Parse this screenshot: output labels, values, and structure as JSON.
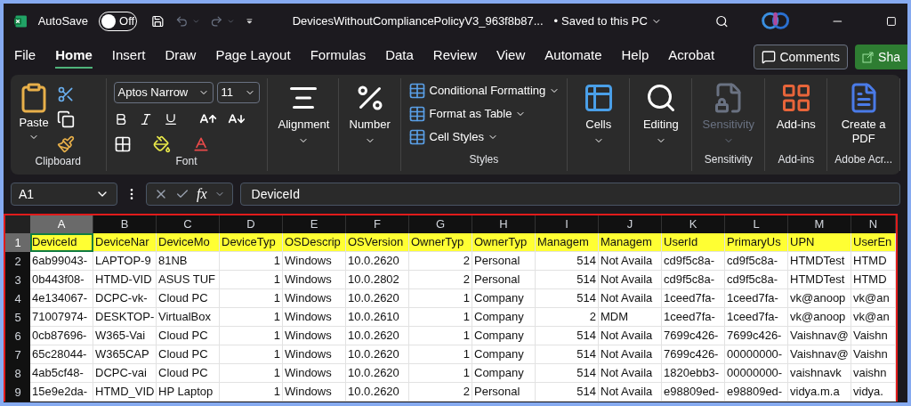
{
  "title_bar": {
    "autosave_label": "AutoSave",
    "autosave": {
      "on": false,
      "label": "Off"
    },
    "document_title": "DevicesWithoutCompliancePolicyV3_963f8b87...",
    "separator": "•",
    "save_status": "Saved to this PC"
  },
  "menu_tabs": [
    {
      "label": "File",
      "selected": false
    },
    {
      "label": "Home",
      "selected": true
    },
    {
      "label": "Insert",
      "selected": false
    },
    {
      "label": "Draw",
      "selected": false
    },
    {
      "label": "Page Layout",
      "selected": false
    },
    {
      "label": "Formulas",
      "selected": false
    },
    {
      "label": "Data",
      "selected": false
    },
    {
      "label": "Review",
      "selected": false
    },
    {
      "label": "View",
      "selected": false
    },
    {
      "label": "Automate",
      "selected": false
    },
    {
      "label": "Help",
      "selected": false
    },
    {
      "label": "Acrobat",
      "selected": false
    }
  ],
  "comments_button": "Comments",
  "share_button": "Sha",
  "ribbon": {
    "clipboard": {
      "paste": "Paste",
      "group": "Clipboard"
    },
    "font": {
      "name": "Aptos Narrow",
      "size": "11",
      "group": "Font"
    },
    "alignment": "Alignment",
    "number": "Number",
    "styles": {
      "items": [
        "Conditional Formatting",
        "Format as Table",
        "Cell Styles"
      ],
      "group": "Styles"
    },
    "big_groups": [
      {
        "kind": "cells",
        "label": "Cells",
        "disabled": false
      },
      {
        "kind": "editing",
        "label": "Editing",
        "disabled": false
      },
      {
        "kind": "sensitivity",
        "label": "Sensitivity",
        "disabled": true,
        "group": "Sensitivity"
      },
      {
        "kind": "addins",
        "label": "Add-ins",
        "disabled": false,
        "group": "Add-ins"
      },
      {
        "kind": "pdf",
        "label": "Create a PDF",
        "disabled": false,
        "group": "Adobe Acr..."
      }
    ]
  },
  "formula_bar": {
    "name_box": "A1",
    "fx": "fx",
    "formula": "DeviceId"
  },
  "grid": {
    "columns": [
      {
        "letter": "A",
        "selected": true,
        "kind": "text"
      },
      {
        "letter": "B",
        "selected": false,
        "kind": "text"
      },
      {
        "letter": "C",
        "selected": false,
        "kind": "text"
      },
      {
        "letter": "D",
        "selected": false,
        "kind": "number"
      },
      {
        "letter": "E",
        "selected": false,
        "kind": "text"
      },
      {
        "letter": "F",
        "selected": false,
        "kind": "text"
      },
      {
        "letter": "G",
        "selected": false,
        "kind": "number"
      },
      {
        "letter": "H",
        "selected": false,
        "kind": "text"
      },
      {
        "letter": "I",
        "selected": false,
        "kind": "number"
      },
      {
        "letter": "J",
        "selected": false,
        "kind": "text"
      },
      {
        "letter": "K",
        "selected": false,
        "kind": "text"
      },
      {
        "letter": "L",
        "selected": false,
        "kind": "text"
      },
      {
        "letter": "M",
        "selected": false,
        "kind": "text"
      },
      {
        "letter": "N",
        "selected": false,
        "kind": "text"
      }
    ],
    "rows": [
      {
        "number": "1",
        "selected": true,
        "header": true,
        "cells": [
          "DeviceId",
          "DeviceNar",
          "DeviceMo",
          "DeviceTyp",
          "OSDescrip",
          "OSVersion",
          "OwnerTyp",
          "OwnerTyp",
          "Managem",
          "Managem",
          "UserId",
          "PrimaryUs",
          "UPN",
          "UserEn"
        ]
      },
      {
        "number": "2",
        "selected": false,
        "header": false,
        "cells": [
          "6ab99043-",
          "LAPTOP-9",
          "81NB",
          "1",
          "Windows",
          "10.0.2620",
          "2",
          "Personal",
          "514",
          "Not Availa",
          "cd9f5c8a-",
          "cd9f5c8a-",
          "HTMDTest",
          "HTMD"
        ]
      },
      {
        "number": "3",
        "selected": false,
        "header": false,
        "cells": [
          "0b443f08-",
          "HTMD-VID",
          "ASUS TUF",
          "1",
          "Windows",
          "10.0.2802",
          "2",
          "Personal",
          "514",
          "Not Availa",
          "cd9f5c8a-",
          "cd9f5c8a-",
          "HTMDTest",
          "HTMD"
        ]
      },
      {
        "number": "4",
        "selected": false,
        "header": false,
        "cells": [
          "4e134067-",
          "DCPC-vk-",
          "Cloud PC",
          "1",
          "Windows",
          "10.0.2620",
          "1",
          "Company",
          "514",
          "Not Availa",
          "1ceed7fa-",
          "1ceed7fa-",
          "vk@anoop",
          "vk@an"
        ]
      },
      {
        "number": "5",
        "selected": false,
        "header": false,
        "cells": [
          "71007974-",
          "DESKTOP-",
          "VirtualBox",
          "1",
          "Windows",
          "10.0.2610",
          "1",
          "Company",
          "2",
          "MDM",
          "1ceed7fa-",
          "1ceed7fa-",
          "vk@anoop",
          "vk@an"
        ]
      },
      {
        "number": "6",
        "selected": false,
        "header": false,
        "cells": [
          "0cb87696-",
          "W365-Vai",
          "Cloud PC",
          "1",
          "Windows",
          "10.0.2620",
          "1",
          "Company",
          "514",
          "Not Availa",
          "7699c426-",
          "7699c426-",
          "Vaishnav@",
          "Vaishn"
        ]
      },
      {
        "number": "7",
        "selected": false,
        "header": false,
        "cells": [
          "65c28044-",
          "W365CAP",
          "Cloud PC",
          "1",
          "Windows",
          "10.0.2620",
          "1",
          "Company",
          "514",
          "Not Availa",
          "7699c426-",
          "00000000-",
          "Vaishnav@",
          "Vaishn"
        ]
      },
      {
        "number": "8",
        "selected": false,
        "header": false,
        "cells": [
          "4ab5cf48-",
          "DCPC-vai",
          "Cloud PC",
          "1",
          "Windows",
          "10.0.2620",
          "1",
          "Company",
          "514",
          "Not Availa",
          "1820ebb3-",
          "00000000-",
          "vaishnavk",
          "vaishn"
        ]
      },
      {
        "number": "9",
        "selected": false,
        "header": false,
        "cells": [
          "15e9e2da-",
          "HTMD_VID",
          "HP Laptop",
          "1",
          "Windows",
          "10.0.2620",
          "2",
          "Personal",
          "514",
          "Not Availa",
          "e98809ed-",
          "e98809ed-",
          "vidya.m.a",
          "vidya."
        ]
      }
    ]
  }
}
